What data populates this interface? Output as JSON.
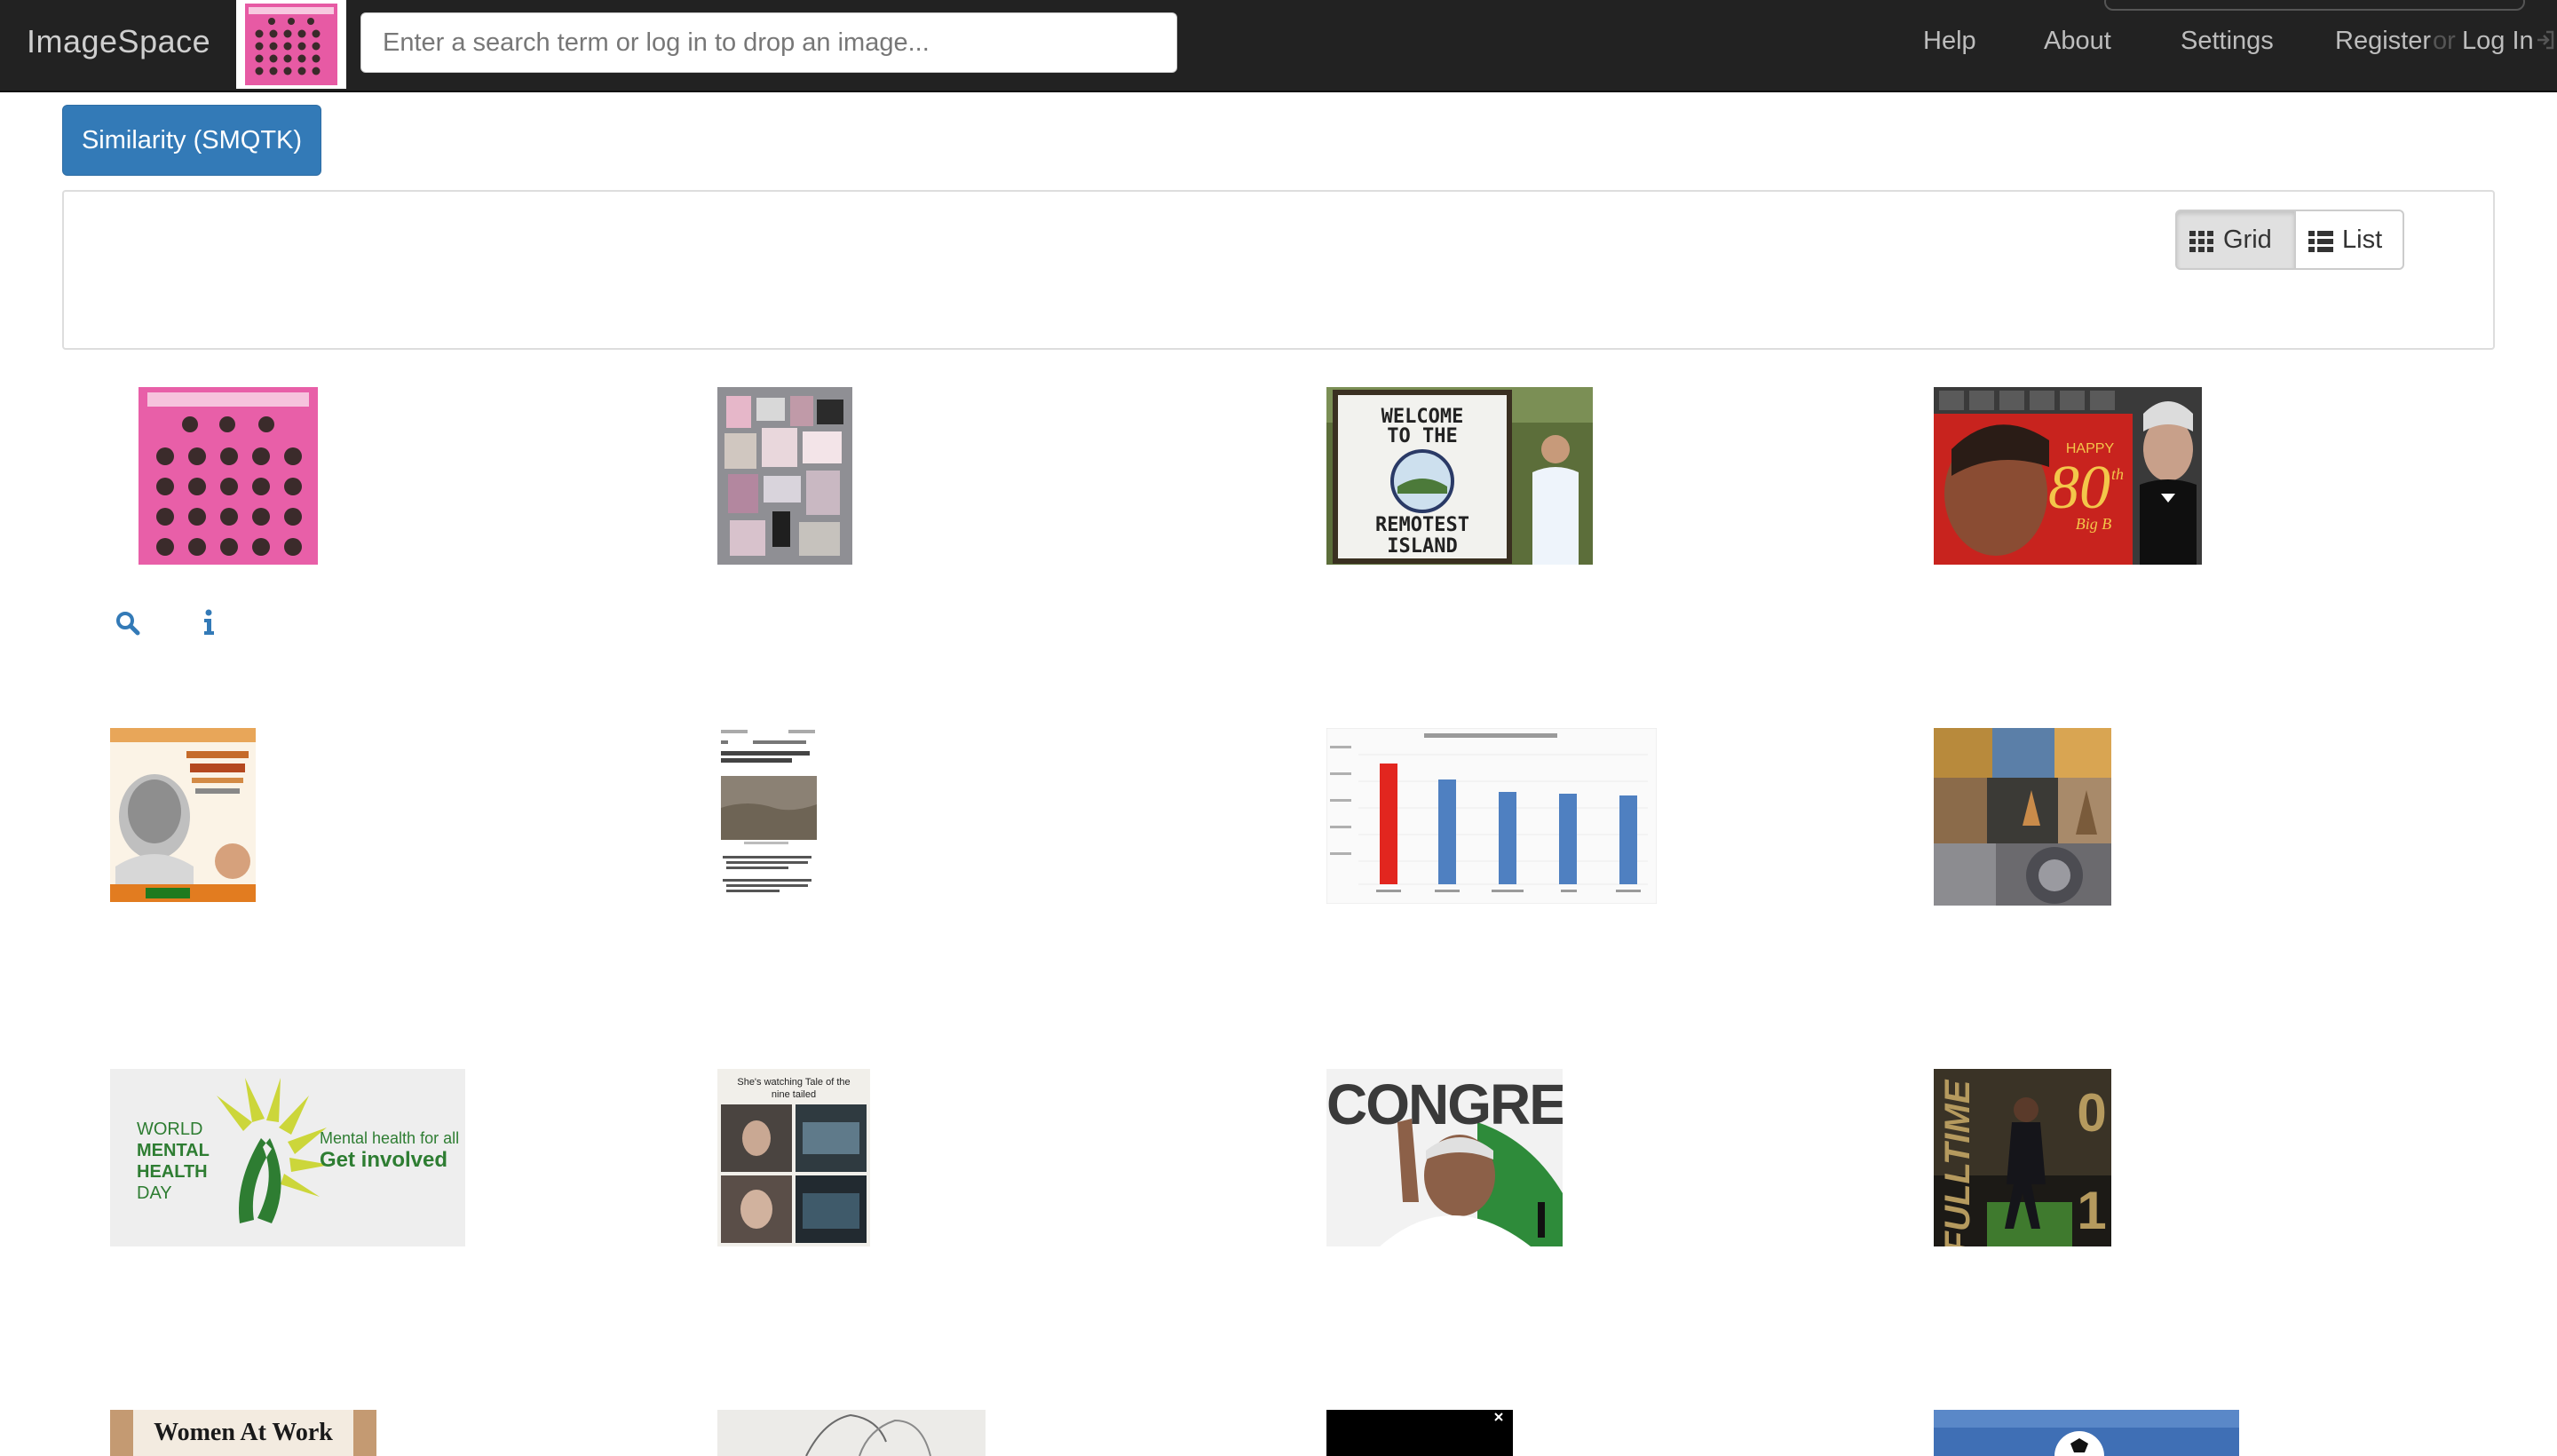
{
  "app": {
    "brand": "ImageSpace"
  },
  "search": {
    "placeholder": "Enter a search term or log in to drop an image..."
  },
  "nav": {
    "help": "Help",
    "about": "About",
    "settings": "Settings",
    "register": "Register",
    "or": "or",
    "login": "Log In"
  },
  "toolbar": {
    "similarity_label": "Similarity (SMQTK)"
  },
  "view_toggle": {
    "grid_label": "Grid",
    "list_label": "List",
    "active": "Grid"
  },
  "results": [
    {
      "id": "r1",
      "thumb": "poster-pink-faces"
    },
    {
      "id": "r2",
      "thumb": "notice-board-collage"
    },
    {
      "id": "r3",
      "thumb": "welcome-remotest-island-sign",
      "text": "WELCOME TO THE REMOTEST ISLAND"
    },
    {
      "id": "r4",
      "thumb": "happy-80th-big-b",
      "text": "HAPPY 80th Big B"
    },
    {
      "id": "r5",
      "thumb": "tribute-poster-portrait"
    },
    {
      "id": "r6",
      "thumb": "news-article-screenshot"
    },
    {
      "id": "r7",
      "thumb": "bar-chart-screenshot"
    },
    {
      "id": "r8",
      "thumb": "statues-collage"
    },
    {
      "id": "r9",
      "thumb": "world-mental-health-day",
      "text": [
        "WORLD",
        "MENTAL",
        "HEALTH",
        "DAY",
        "Mental health for all",
        "Get involved"
      ]
    },
    {
      "id": "r10",
      "thumb": "tale-of-nine-tailed-meme",
      "text": "She's watching Tale of the nine tailed"
    },
    {
      "id": "r11",
      "thumb": "congress-politician",
      "text": "CONGRES"
    },
    {
      "id": "r12",
      "thumb": "fulltime-football",
      "text": [
        "FULLTIME",
        "0",
        "1"
      ]
    },
    {
      "id": "r13",
      "thumb": "women-at-work",
      "text": "Women At Work"
    },
    {
      "id": "r14",
      "thumb": "sketch-drawing"
    },
    {
      "id": "r15",
      "thumb": "black-image"
    },
    {
      "id": "r16",
      "thumb": "football-sky"
    }
  ],
  "result_actions": {
    "search_icon": "search-icon",
    "info_icon": "info-icon"
  },
  "colors": {
    "navbar": "#222222",
    "primary": "#337ab7",
    "link": "#337ab7"
  }
}
